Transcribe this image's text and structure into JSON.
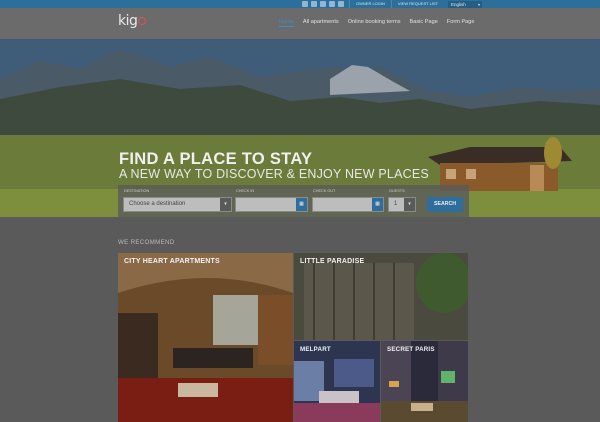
{
  "topbar": {
    "social_icons": [
      "twitter-icon",
      "facebook-icon",
      "google-plus-icon",
      "linkedin-icon",
      "instagram-icon"
    ],
    "links": [
      "OWNER LOGIN",
      "VIEW REQUEST LIST"
    ],
    "language": "English"
  },
  "header": {
    "logo": "kig",
    "nav": [
      "Home",
      "All apartments",
      "Online booking terms",
      "Basic Page",
      "Form Page"
    ],
    "active_nav": "Home"
  },
  "hero": {
    "title": "FIND A PLACE TO STAY",
    "subtitle": "A NEW WAY TO DISCOVER & ENJOY NEW PLACES"
  },
  "search": {
    "destination_label": "DESTINATION",
    "destination_value": "Choose a destination",
    "checkin_label": "CHECK IN",
    "checkout_label": "CHECK OUT",
    "guests_label": "GUESTS",
    "guests_value": "1",
    "button": "SEARCH"
  },
  "recommend": {
    "title": "WE RECOMMEND",
    "cards": [
      "CITY HEART APARTMENTS",
      "LITTLE PARADISE",
      "MELPART",
      "SECRET PARIS"
    ]
  },
  "colors": {
    "accent": "#2f6e9c",
    "logo_accent": "#d9534f"
  }
}
